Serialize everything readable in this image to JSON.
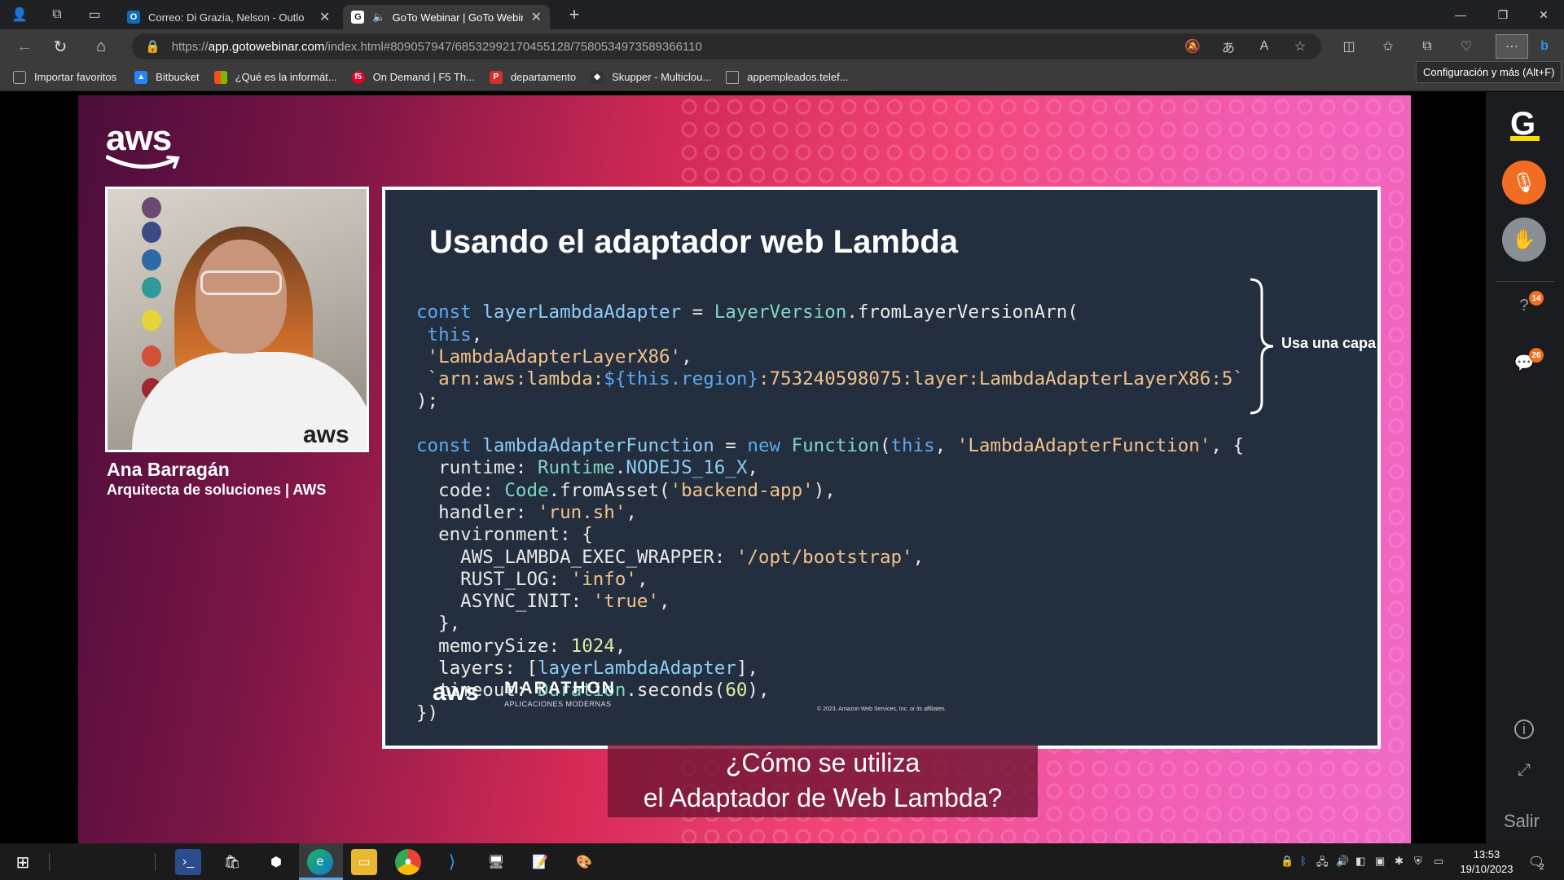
{
  "browser": {
    "tabs": [
      {
        "label": "Correo: Di Grazia, Nelson - Outlo",
        "icon": "outlook-icon",
        "color": "#0f6cbd"
      },
      {
        "label": "GoTo Webinar | GoTo Webin",
        "icon": "goto-icon",
        "color": "#ffffff"
      }
    ],
    "url_scheme": "https://",
    "url_host": "app.gotowebinar.com",
    "url_path": "/index.html#809057947/68532992170455128/7580534973589366110",
    "bookmarks": [
      {
        "label": "Importar favoritos",
        "icon": "import-icon",
        "color": "#666666"
      },
      {
        "label": "Bitbucket",
        "icon": "bitbucket-icon",
        "color": "#2684ff"
      },
      {
        "label": "¿Qué es la informát...",
        "icon": "windows-icon",
        "color": "#f25022"
      },
      {
        "label": "On Demand | F5 Th...",
        "icon": "f5-icon",
        "color": "#e4002b"
      },
      {
        "label": "departamento",
        "icon": "pdf-icon",
        "color": "#d32f2f"
      },
      {
        "label": "Skupper - Multiclou...",
        "icon": "skupper-icon",
        "color": "#333333"
      },
      {
        "label": "appempleados.telef...",
        "icon": "page-icon",
        "color": "#666666"
      }
    ],
    "tooltip": "Configuración y más (Alt+F)"
  },
  "webinar": {
    "brand": "aws",
    "speaker_name": "Ana Barragán",
    "speaker_role": "Arquitecta de soluciones | AWS",
    "hoodie_logo": "aws",
    "slide": {
      "title": "Usando el adaptador web Lambda",
      "brace_label": "Usa una capa",
      "footer_brand": "aws",
      "footer_title": "MARATHON",
      "footer_subtitle": "APLICACIONES MODERNAS",
      "copyright": "© 2023, Amazon Web Services, Inc. or its affiliates.",
      "code_lines": [
        "const layerLambdaAdapter = LayerVersion.fromLayerVersionArn(",
        " this,",
        " 'LambdaAdapterLayerX86',",
        " `arn:aws:lambda:${this.region}:753240598075:layer:LambdaAdapterLayerX86:5`",
        ");",
        "",
        "const lambdaAdapterFunction = new Function(this, 'LambdaAdapterFunction', {",
        "  runtime: Runtime.NODEJS_16_X,",
        "  code: Code.fromAsset('backend-app'),",
        "  handler: 'run.sh',",
        "  environment: {",
        "    AWS_LAMBDA_EXEC_WRAPPER: '/opt/bootstrap',",
        "    RUST_LOG: 'info',",
        "    ASYNC_INIT: 'true',",
        "  },",
        "  memorySize: 1024,",
        "  layers: [layerLambdaAdapter],",
        "  timeout: Duration.seconds(60),",
        "})"
      ]
    },
    "subtitle_line1": "¿Cómo se utiliza",
    "subtitle_line2": "el Adaptador de Web Lambda?"
  },
  "goto_panel": {
    "logo": "G",
    "mic_icon": "mic-muted-icon",
    "hand_icon": "raise-hand-icon",
    "questions_badge": "14",
    "chat_badge": "26",
    "exit_label": "Salir",
    "accent": "#f26c22"
  },
  "taskbar": {
    "time": "13:53",
    "date": "19/10/2023",
    "notifications": "2"
  }
}
